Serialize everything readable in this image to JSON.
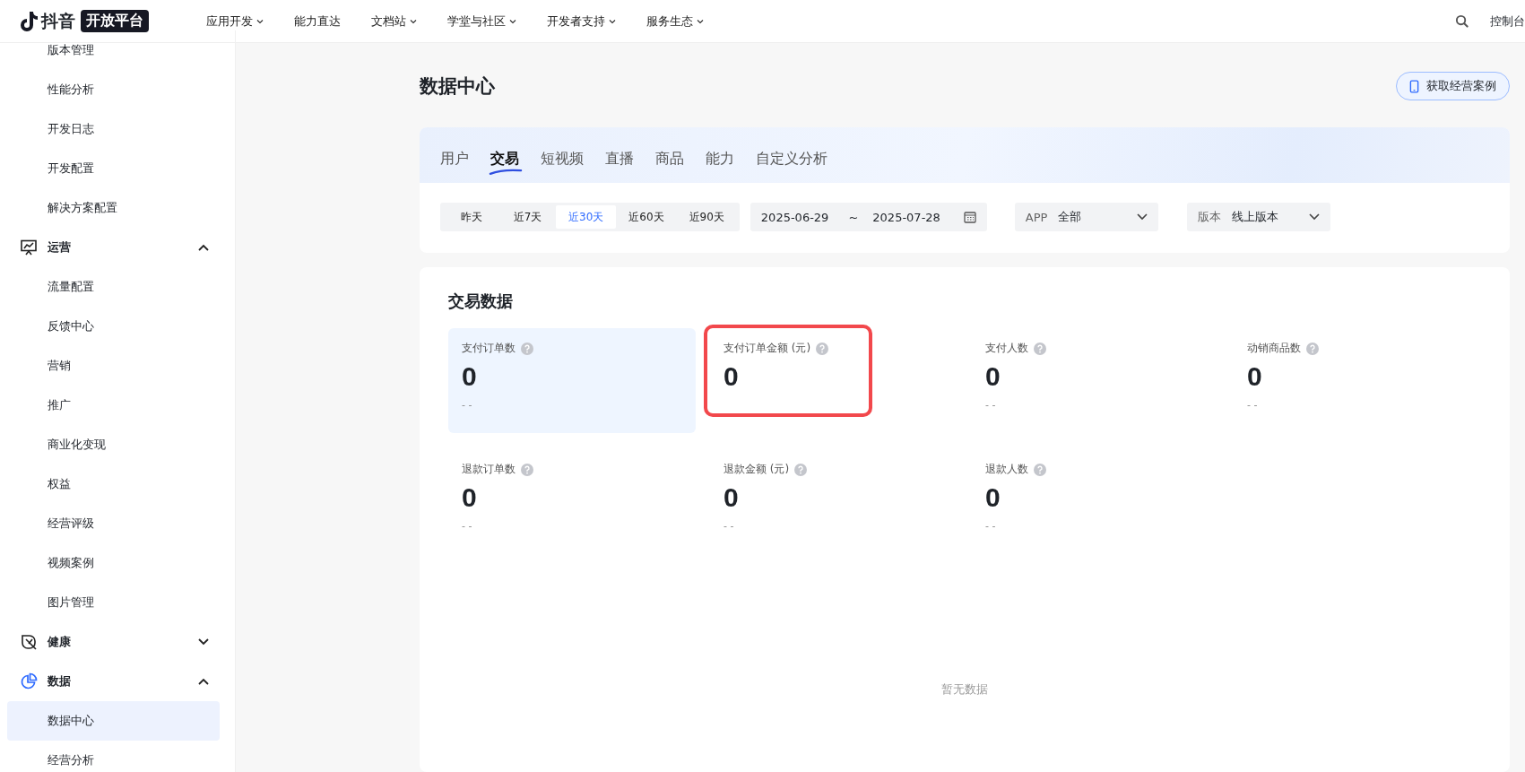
{
  "nav": {
    "logo_text": "抖音",
    "logo_badge": "开放平台",
    "items": [
      {
        "label": "应用开发",
        "dropdown": true
      },
      {
        "label": "能力直达",
        "dropdown": false
      },
      {
        "label": "文档站",
        "dropdown": true
      },
      {
        "label": "学堂与社区",
        "dropdown": true
      },
      {
        "label": "开发者支持",
        "dropdown": true
      },
      {
        "label": "服务生态",
        "dropdown": true
      }
    ],
    "console": "控制台"
  },
  "sidebar": {
    "items": [
      {
        "kind": "item",
        "label": "版本管理",
        "selected": false
      },
      {
        "kind": "item",
        "label": "性能分析",
        "selected": false
      },
      {
        "kind": "item",
        "label": "开发日志",
        "selected": false
      },
      {
        "kind": "item",
        "label": "开发配置",
        "selected": false
      },
      {
        "kind": "item",
        "label": "解决方案配置",
        "selected": false
      },
      {
        "kind": "group",
        "label": "运营",
        "expanded": true,
        "children": [
          {
            "label": "流量配置",
            "selected": false
          },
          {
            "label": "反馈中心",
            "selected": false
          },
          {
            "label": "营销",
            "selected": false
          },
          {
            "label": "推广",
            "selected": false
          },
          {
            "label": "商业化变现",
            "selected": false
          },
          {
            "label": "权益",
            "selected": false
          },
          {
            "label": "经营评级",
            "selected": false
          },
          {
            "label": "视频案例",
            "selected": false
          },
          {
            "label": "图片管理",
            "selected": false
          }
        ]
      },
      {
        "kind": "group",
        "label": "健康",
        "expanded": false
      },
      {
        "kind": "group",
        "label": "数据",
        "expanded": true,
        "children": [
          {
            "label": "数据中心",
            "selected": true
          },
          {
            "label": "经营分析",
            "selected": false
          }
        ]
      }
    ]
  },
  "page": {
    "title": "数据中心",
    "case_button": "获取经营案例"
  },
  "tabs": [
    {
      "label": "用户",
      "selected": false
    },
    {
      "label": "交易",
      "selected": true
    },
    {
      "label": "短视频",
      "selected": false
    },
    {
      "label": "直播",
      "selected": false
    },
    {
      "label": "商品",
      "selected": false
    },
    {
      "label": "能力",
      "selected": false
    },
    {
      "label": "自定义分析",
      "selected": false
    }
  ],
  "filters": {
    "ranges": [
      {
        "label": "昨天",
        "selected": false
      },
      {
        "label": "近7天",
        "selected": false
      },
      {
        "label": "近30天",
        "selected": true
      },
      {
        "label": "近60天",
        "selected": false
      },
      {
        "label": "近90天",
        "selected": false
      }
    ],
    "date_start": "2025-06-29",
    "date_sep": "~",
    "date_end": "2025-07-28",
    "app_label": "APP",
    "app_value": "全部",
    "version_label": "版本",
    "version_value": "线上版本"
  },
  "trade": {
    "title": "交易数据",
    "metrics": [
      {
        "label": "支付订单数",
        "value": "0",
        "compare": "- -",
        "selected": true,
        "highlighted": false
      },
      {
        "label": "支付订单金额 (元)",
        "value": "0",
        "selected": false,
        "highlighted": true
      },
      {
        "label": "支付人数",
        "value": "0",
        "compare": "- -",
        "selected": false,
        "highlighted": false
      },
      {
        "label": "动销商品数",
        "value": "0",
        "compare": "- -",
        "selected": false,
        "highlighted": false
      },
      {
        "label": "退款订单数",
        "value": "0",
        "compare": "- -",
        "selected": false,
        "highlighted": false
      },
      {
        "label": "退款金额 (元)",
        "value": "0",
        "compare": "- -",
        "selected": false,
        "highlighted": false
      },
      {
        "label": "退款人数",
        "value": "0",
        "compare": "- -",
        "selected": false,
        "highlighted": false
      }
    ],
    "empty": "暂无数据"
  }
}
